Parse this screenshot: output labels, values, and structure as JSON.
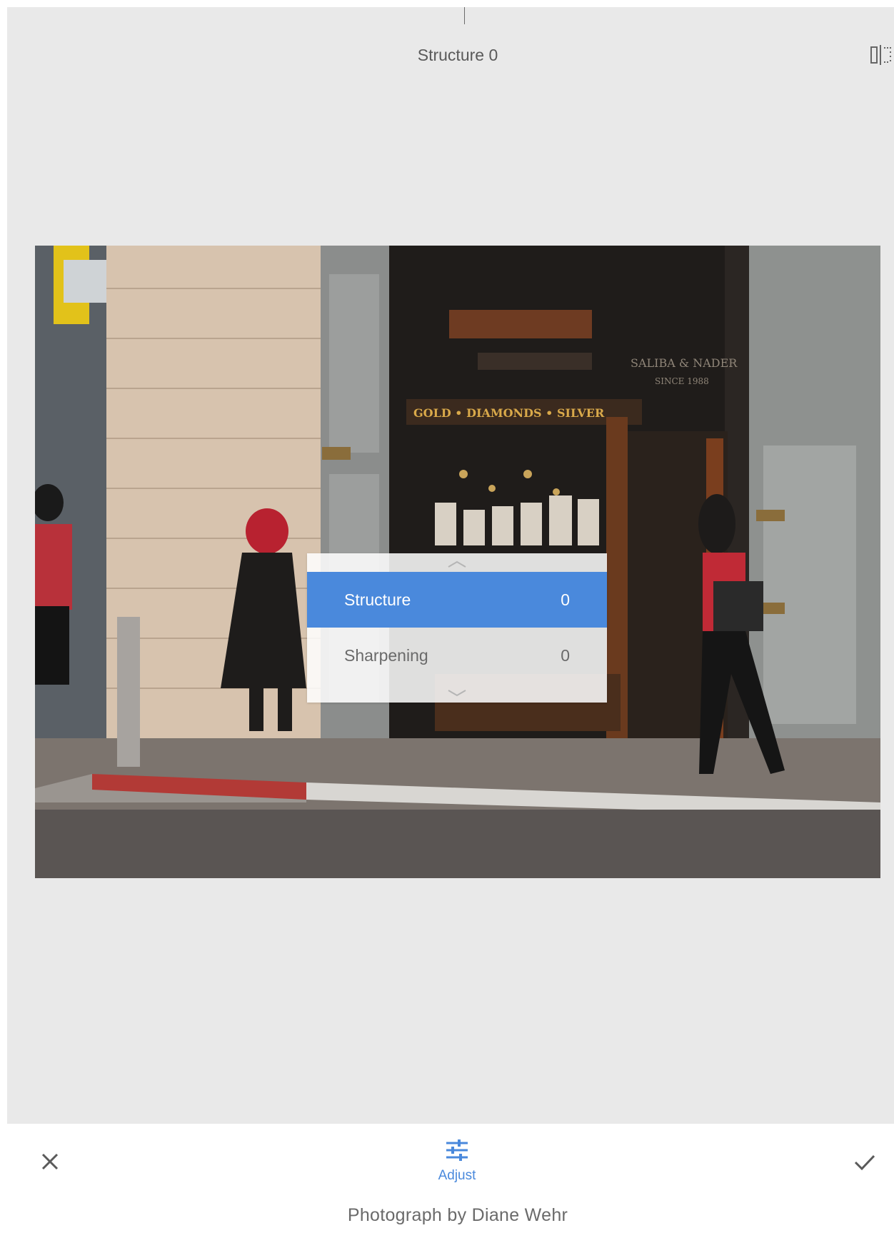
{
  "header": {
    "title": "Structure 0",
    "compare_icon": "compare-icon"
  },
  "adjust_menu": {
    "items": [
      {
        "label": "Structure",
        "value": "0",
        "selected": true
      },
      {
        "label": "Sharpening",
        "value": "0",
        "selected": false
      }
    ],
    "accent_color": "#4a89dc"
  },
  "photo": {
    "signs": {
      "store_line": "GOLD • DIAMONDS • SILVER",
      "store_name": "SALIBA & NADER",
      "since": "SINCE 1988"
    }
  },
  "toolbar": {
    "cancel_icon": "close-icon",
    "apply_icon": "checkmark-icon",
    "tool_icon": "sliders-icon",
    "tool_label": "Adjust"
  },
  "caption": "Photograph by Diane Wehr"
}
